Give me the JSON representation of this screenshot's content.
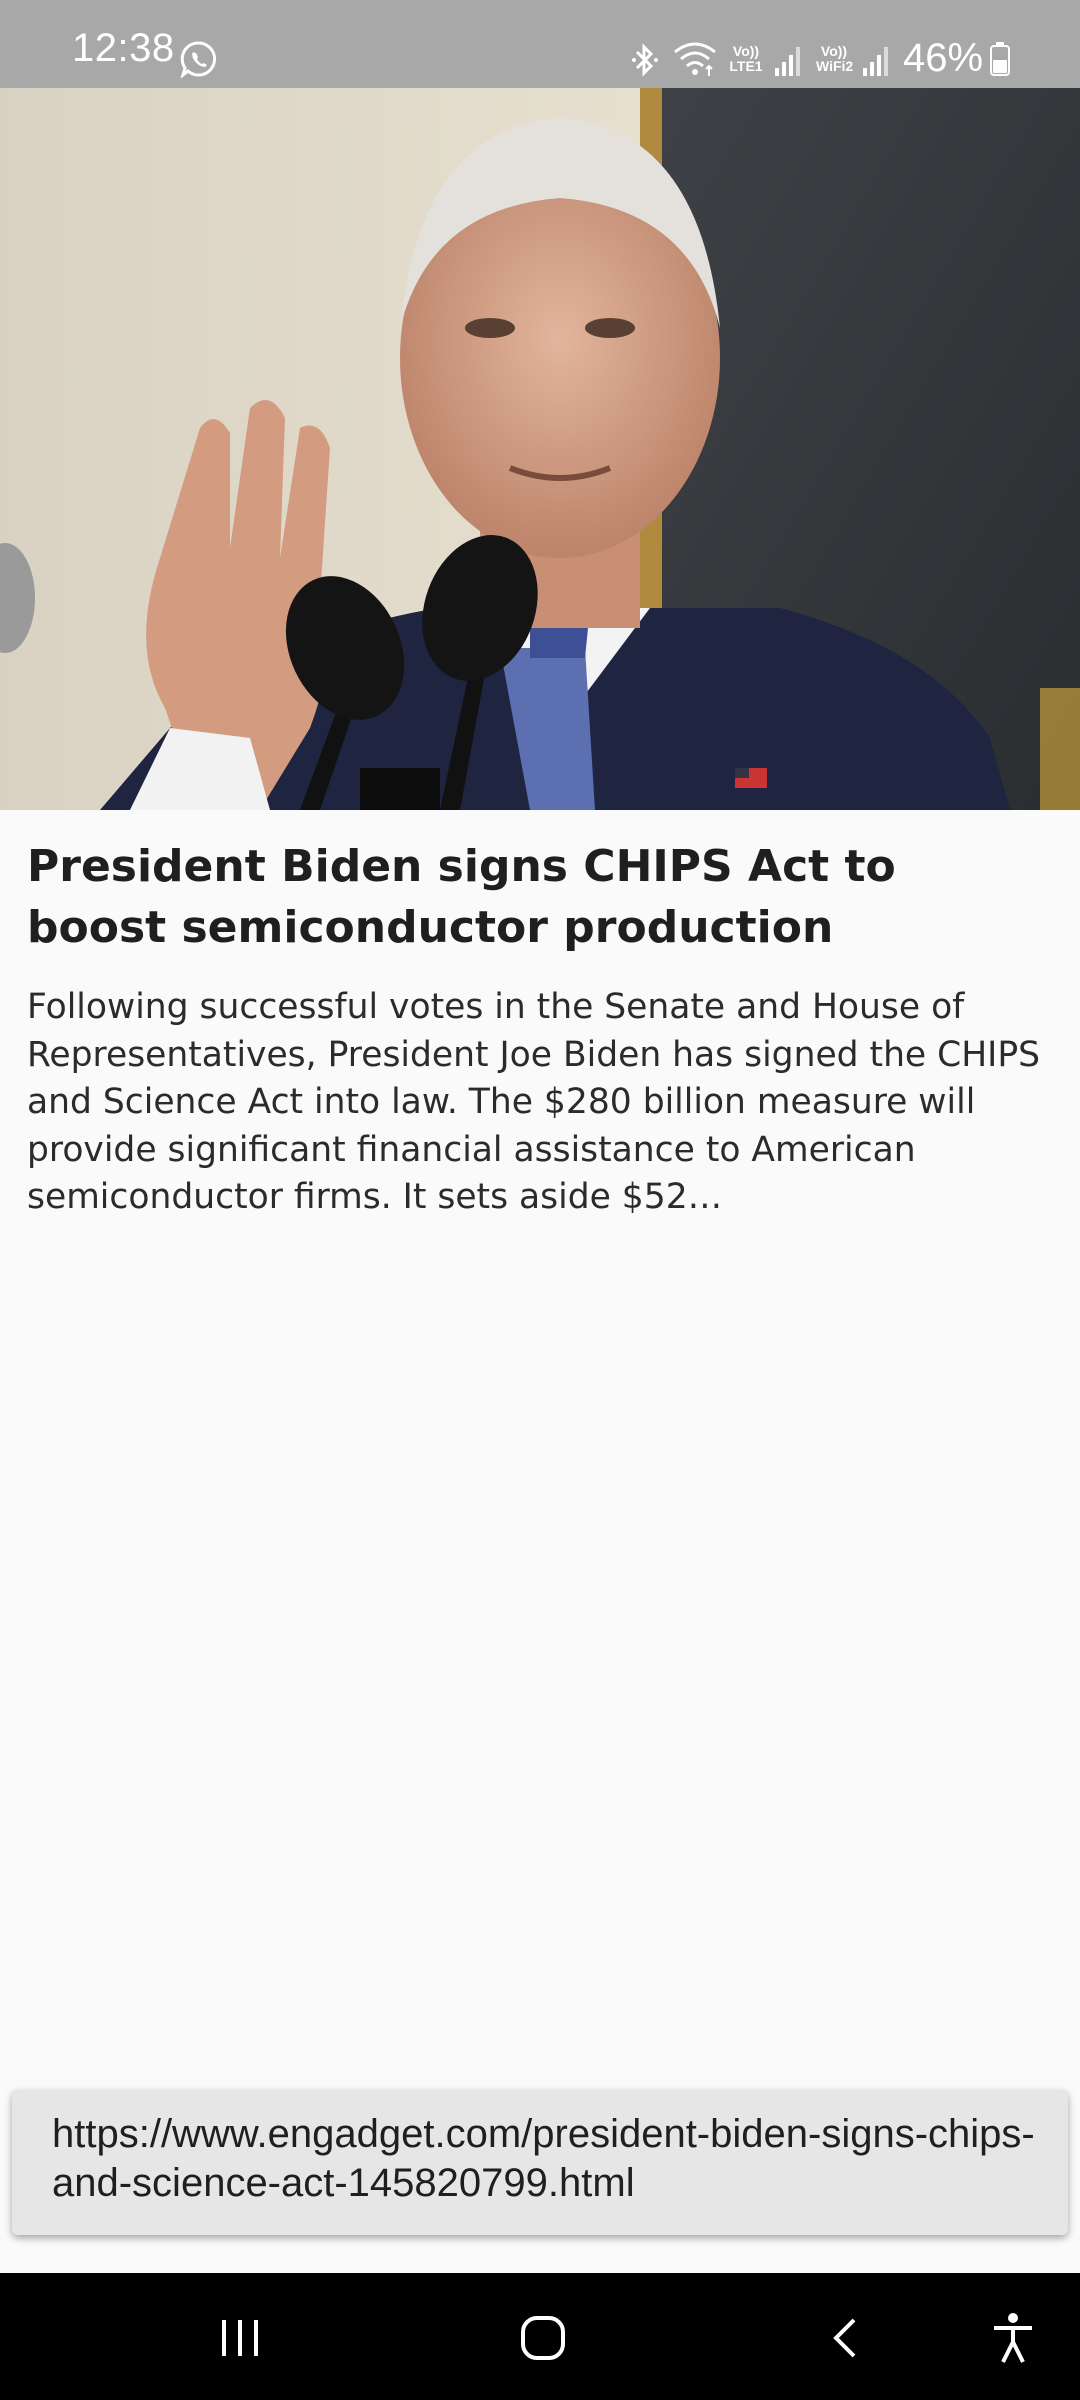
{
  "status_bar": {
    "time": "12:38",
    "battery": "46%",
    "net1_label": "Vo))\nLTE1",
    "net2_label": "Vo))\nWiFi2",
    "icons": [
      "whatsapp-icon",
      "bluetooth-icon",
      "wifi-icon",
      "signal-icon",
      "battery-icon"
    ]
  },
  "article": {
    "headline": "President Biden signs CHIPS Act to boost semiconductor production",
    "summary": "Following successful votes in the Senate and House of Representatives, President Joe Biden has signed the CHIPS and Science Act into law. The $280 billion measure will provide significant financial assistance to American semiconductor firms. It sets aside $52…"
  },
  "url_card": {
    "url": "https://www.engadget.com/president-biden-signs-chips-and-science-act-145820799.html"
  },
  "nav_bar": {
    "buttons": [
      "recent-apps",
      "home",
      "back",
      "accessibility"
    ]
  },
  "colors": {
    "status_bar": "#a8a8a8",
    "background": "#fafafa",
    "url_card": "#e6e6e6",
    "nav_bar": "#000000"
  }
}
